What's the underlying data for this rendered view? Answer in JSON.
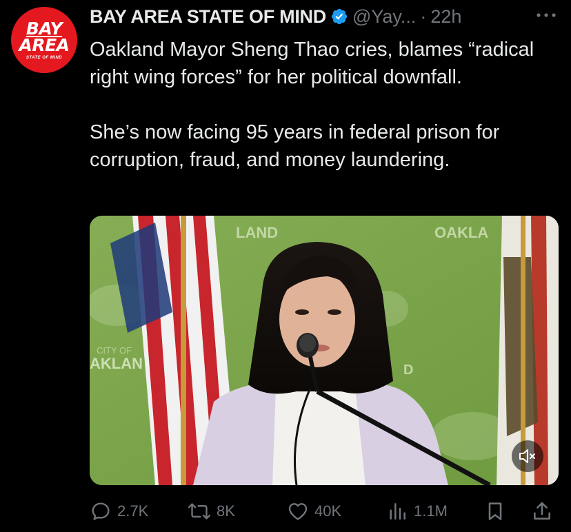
{
  "author": {
    "display_name": "BAY AREA STATE OF MIND",
    "handle": "@Yay...",
    "separator": "·",
    "time": "22h",
    "avatar": {
      "line1": "BAY",
      "line2": "AREA",
      "line3": "STATE OF MIND",
      "color": "#e4191f"
    },
    "verified_icon": "verified-badge-icon",
    "verified_color": "#1d9bf0"
  },
  "tweet": {
    "paragraphs": [
      "Oakland Mayor Sheng Thao cries, blames “radical right wing forces” for her political downfall.",
      "She’s now facing 95 years in federal prison for corruption, fraud, and money laundering."
    ]
  },
  "media": {
    "type": "video",
    "backdrop_texts": [
      "LAND",
      "OAKLA",
      "CITY OF",
      "AKLAN",
      "D"
    ],
    "mute_icon": "speaker-muted-icon"
  },
  "actions": {
    "reply": {
      "icon": "reply-icon",
      "count": "2.7K"
    },
    "retweet": {
      "icon": "retweet-icon",
      "count": "8K"
    },
    "like": {
      "icon": "heart-icon",
      "count": "40K"
    },
    "views": {
      "icon": "views-chart-icon",
      "count": "1.1M"
    },
    "bookmark": {
      "icon": "bookmark-icon"
    },
    "share": {
      "icon": "share-icon"
    }
  },
  "colors": {
    "background": "#000000",
    "text": "#e7e9ea",
    "muted": "#71767b"
  }
}
